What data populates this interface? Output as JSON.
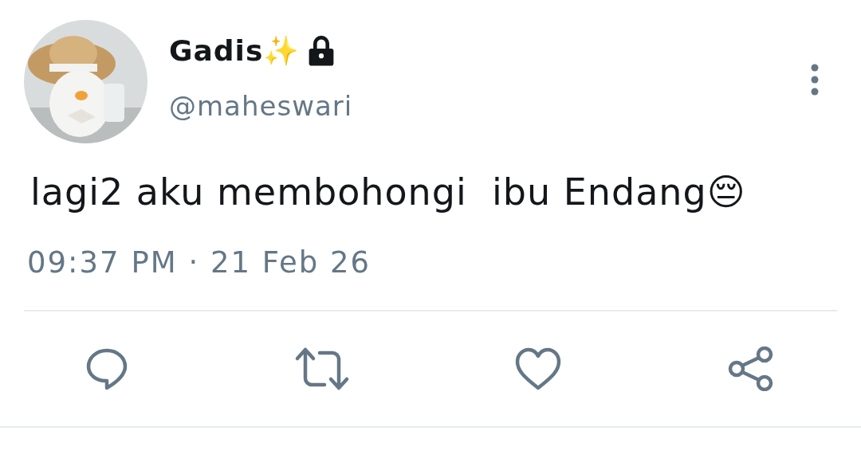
{
  "tweet": {
    "name": "Gadis✨",
    "protected": true,
    "handle": "@maheswari",
    "text": "lagi2 aku membohongi  ibu Endang😔",
    "timestamp": "09:37 PM · 21 Feb 26"
  },
  "actions": [
    {
      "kind": "reply"
    },
    {
      "kind": "retweet"
    },
    {
      "kind": "like"
    },
    {
      "kind": "share"
    }
  ]
}
